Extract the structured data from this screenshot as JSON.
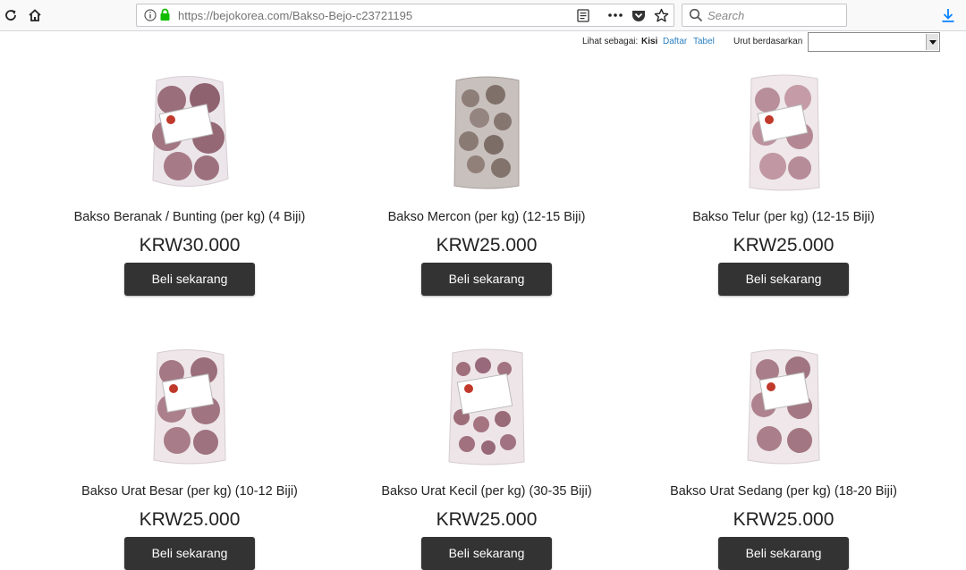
{
  "browser": {
    "url_host": "https://bejokorea.com",
    "url_path": "/Bakso-Bejo-c23721195",
    "search_placeholder": "Search"
  },
  "viewbar": {
    "view_as_label": "Lihat sebagai:",
    "view_grid": "Kisi",
    "view_list": "Daftar",
    "view_table": "Tabel",
    "sort_label": "Urut berdasarkan",
    "sort_value": ""
  },
  "products": [
    {
      "name": "Bakso Beranak / Bunting (per kg) (4 Biji)",
      "price": "KRW30.000",
      "button": "Beli sekarang"
    },
    {
      "name": "Bakso Mercon (per kg) (12-15 Biji)",
      "price": "KRW25.000",
      "button": "Beli sekarang"
    },
    {
      "name": "Bakso Telur (per kg) (12-15 Biji)",
      "price": "KRW25.000",
      "button": "Beli sekarang"
    },
    {
      "name": "Bakso Urat Besar (per kg) (10-12 Biji)",
      "price": "KRW25.000",
      "button": "Beli sekarang"
    },
    {
      "name": "Bakso Urat Kecil (per kg) (30-35 Biji)",
      "price": "KRW25.000",
      "button": "Beli sekarang"
    },
    {
      "name": "Bakso Urat Sedang (per kg) (18-20 Biji)",
      "price": "KRW25.000",
      "button": "Beli sekarang"
    }
  ],
  "colors": {
    "button_bg": "#333333",
    "link": "#2a7fc1",
    "secure_lock": "#12bc00",
    "download": "#0a84ff"
  }
}
